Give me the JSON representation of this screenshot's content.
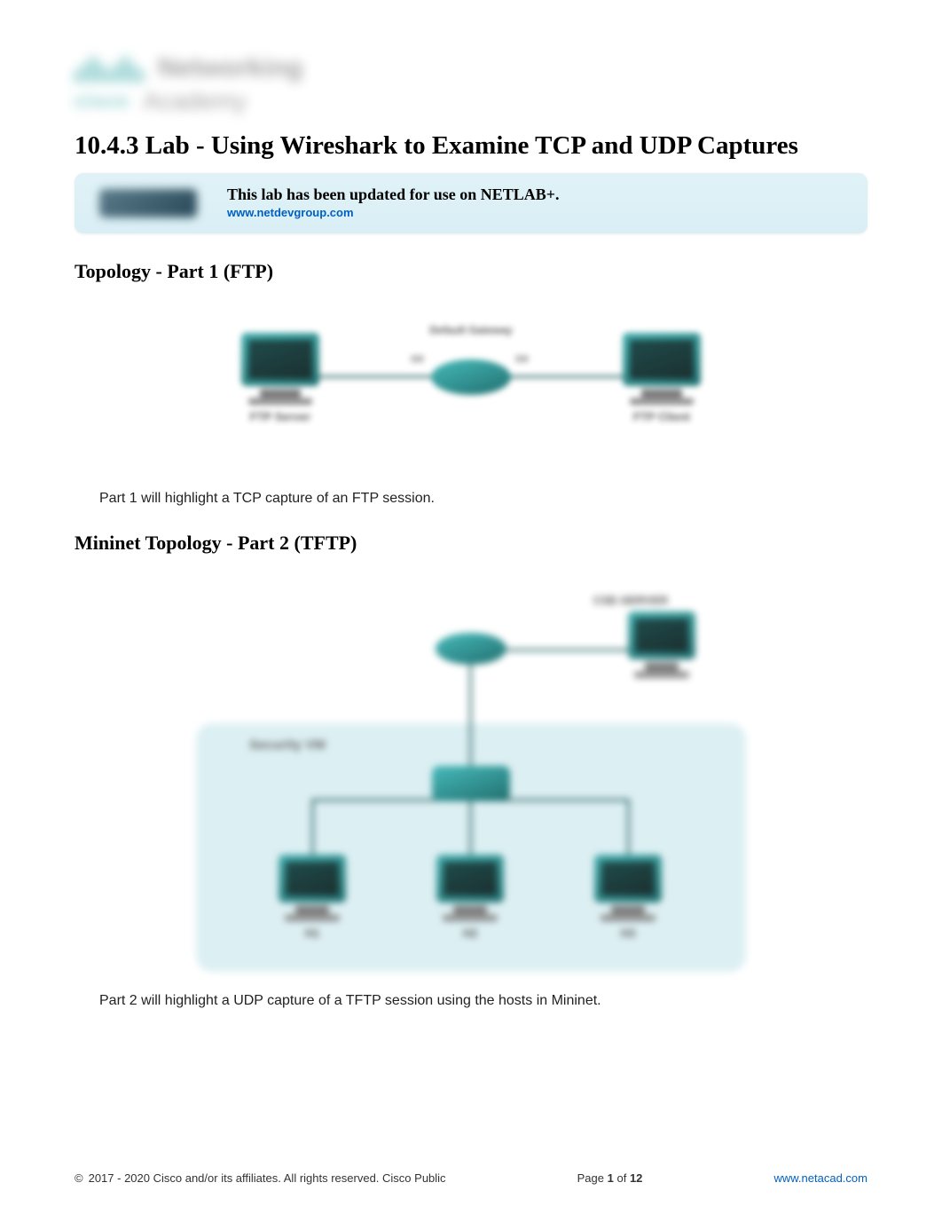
{
  "logo": {
    "brand": "cisco",
    "line1": "Networking",
    "line2": "Academy"
  },
  "title": "10.4.3 Lab - Using Wireshark to Examine TCP and UDP Captures",
  "notice": {
    "text": "This lab has been updated for use on NETLAB+.",
    "link": "www.netdevgroup.com"
  },
  "section1_heading": "Topology - Part 1 (FTP)",
  "diagram1": {
    "left_label": "FTP Server",
    "left_iface": "G0",
    "center_label": "Default Gateway",
    "right_iface": "G0",
    "right_label": "FTP Client"
  },
  "section1_body": "Part 1 will highlight a TCP capture of an FTP session.",
  "section2_heading": "Mininet Topology - Part 2 (TFTP)",
  "diagram2": {
    "top_right_label": "CSE-SERVER",
    "vm_label": "Security VM",
    "hosts": [
      "H1",
      "H2",
      "H3"
    ]
  },
  "section2_body": "Part 2 will highlight a UDP capture of a TFTP session using the hosts in Mininet.",
  "footer": {
    "copyright": "2017 - 2020 Cisco and/or its affiliates. All rights reserved. Cisco Public",
    "page_prefix": "Page ",
    "page_current": "1",
    "page_of": " of ",
    "page_total": "12",
    "link": "www.netacad.com"
  }
}
